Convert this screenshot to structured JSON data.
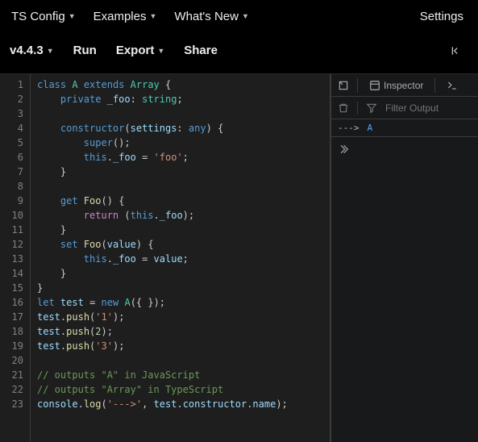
{
  "topbar": {
    "ts_config": "TS Config",
    "examples": "Examples",
    "whats_new": "What's New",
    "settings": "Settings"
  },
  "toolbar": {
    "version": "v4.4.3",
    "run": "Run",
    "export": "Export",
    "share": "Share"
  },
  "editor": {
    "lines": [
      1,
      2,
      3,
      4,
      5,
      6,
      7,
      8,
      9,
      10,
      11,
      12,
      13,
      14,
      15,
      16,
      17,
      18,
      19,
      20,
      21,
      22,
      23
    ],
    "code": {
      "className": "A",
      "extends": "Array",
      "privateField": "_foo",
      "privateType": "string",
      "ctorParam": "settings",
      "ctorParamType": "any",
      "fooStr": "'foo'",
      "getterName": "Foo",
      "setterParam": "value",
      "varName": "test",
      "push1": "'1'",
      "push2": "2",
      "push3": "'3'",
      "cmt1": "// outputs \"A\" in JavaScript",
      "cmt2": "// outputs \"Array\" in TypeScript",
      "logArrow": "'--->'",
      "logProp1": "constructor",
      "logProp2": "name"
    }
  },
  "devtools": {
    "inspector_label": "Inspector",
    "filter_placeholder": "Filter Output"
  },
  "console": {
    "arg1": "--->",
    "arg2": "A"
  }
}
